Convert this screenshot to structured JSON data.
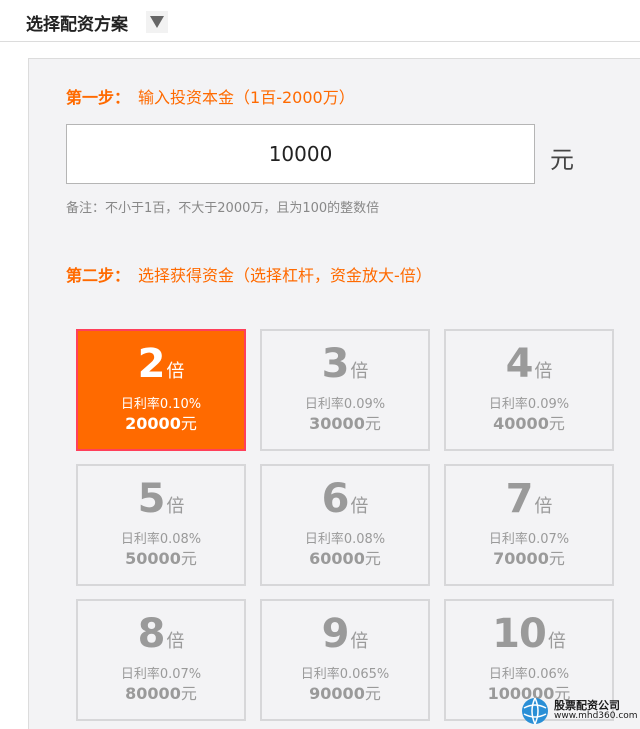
{
  "header": {
    "title": "选择配资方案",
    "dropdown_icon": "triangle-down-icon"
  },
  "step1": {
    "label": "第一步：",
    "text": "输入投资本金（1百-2000万）",
    "amount_value": "10000",
    "unit": "元",
    "note": "备注：不小于1百，不大于2000万，且为100的整数倍"
  },
  "step2": {
    "label": "第二步：",
    "text": "选择获得资金（选择杠杆，资金放大-倍）"
  },
  "options": [
    {
      "multiple": "2",
      "unit": "倍",
      "rate": "日利率0.10%",
      "amount": "20000",
      "currency": "元",
      "selected": true
    },
    {
      "multiple": "3",
      "unit": "倍",
      "rate": "日利率0.09%",
      "amount": "30000",
      "currency": "元",
      "selected": false
    },
    {
      "multiple": "4",
      "unit": "倍",
      "rate": "日利率0.09%",
      "amount": "40000",
      "currency": "元",
      "selected": false
    },
    {
      "multiple": "5",
      "unit": "倍",
      "rate": "日利率0.08%",
      "amount": "50000",
      "currency": "元",
      "selected": false
    },
    {
      "multiple": "6",
      "unit": "倍",
      "rate": "日利率0.08%",
      "amount": "60000",
      "currency": "元",
      "selected": false
    },
    {
      "multiple": "7",
      "unit": "倍",
      "rate": "日利率0.07%",
      "amount": "70000",
      "currency": "元",
      "selected": false
    },
    {
      "multiple": "8",
      "unit": "倍",
      "rate": "日利率0.07%",
      "amount": "80000",
      "currency": "元",
      "selected": false
    },
    {
      "multiple": "9",
      "unit": "倍",
      "rate": "日利率0.065%",
      "amount": "90000",
      "currency": "元",
      "selected": false
    },
    {
      "multiple": "10",
      "unit": "倍",
      "rate": "日利率0.06%",
      "amount": "100000",
      "currency": "元",
      "selected": false
    }
  ],
  "watermark": {
    "name": "股票配资公司",
    "url": "www.mhd360.com"
  },
  "colors": {
    "accent": "#ff6a00",
    "selected_border": "#ff3f5a",
    "card_text": "#9a9a9a"
  }
}
